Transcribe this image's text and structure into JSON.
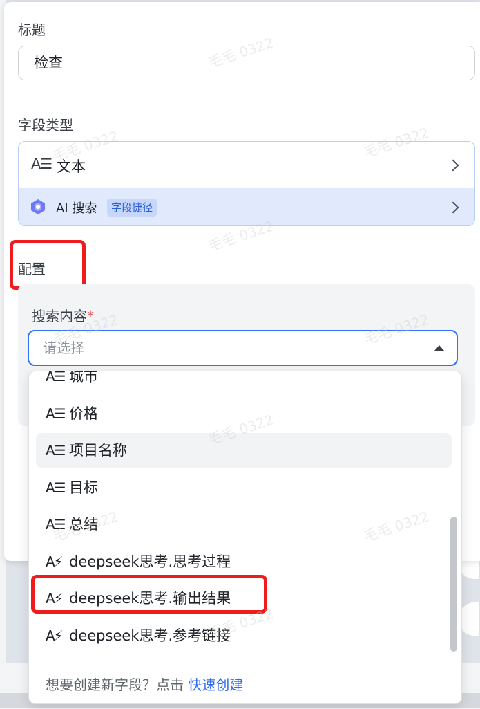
{
  "form": {
    "title_label": "标题",
    "title_value": "检查",
    "field_type_label": "字段类型",
    "type_text_icon": "A☰",
    "type_text_label": "文本",
    "ai_search_label": "AI 搜索",
    "ai_search_tag": "字段捷径",
    "config_label": "配置",
    "search_content_label": "搜索内容",
    "required_mark": "*",
    "select_placeholder": "请选择"
  },
  "dropdown": {
    "options": [
      {
        "icon": "A☰",
        "label": "城市"
      },
      {
        "icon": "A☰",
        "label": "价格"
      },
      {
        "icon": "A☰",
        "label": "项目名称"
      },
      {
        "icon": "A☰",
        "label": "目标"
      },
      {
        "icon": "A☰",
        "label": "总结"
      },
      {
        "icon": "A⚡",
        "label": "deepseek思考.思考过程"
      },
      {
        "icon": "A⚡",
        "label": "deepseek思考.输出结果"
      },
      {
        "icon": "A⚡",
        "label": "deepseek思考.参考链接"
      }
    ],
    "footer_text": "想要创建新字段？点击",
    "footer_link": "快速创建"
  },
  "watermark": "毛毛 0322",
  "colors": {
    "accent": "#3370ff",
    "highlight": "#ee1c1c",
    "ai_row_bg": "#e1eafd"
  }
}
